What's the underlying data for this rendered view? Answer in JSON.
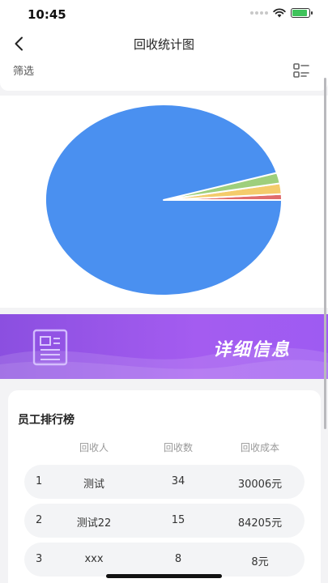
{
  "status_bar": {
    "time": "10:45",
    "battery_level": 0.9,
    "battery_color": "#3fc35b"
  },
  "nav": {
    "title": "回收统计图",
    "back_icon": "chevron-left-icon"
  },
  "filter": {
    "label": "筛选",
    "icon": "filter-list-icon"
  },
  "chart_data": {
    "type": "pie",
    "title": "",
    "slices": [
      {
        "value": 1,
        "color": "#e06c6c"
      },
      {
        "value": 1.8,
        "color": "#f4cb6b"
      },
      {
        "value": 1.8,
        "color": "#9ecf7c"
      },
      {
        "value": 95.4,
        "color": "#4a90f0"
      }
    ]
  },
  "banner": {
    "title": "详细信息",
    "icon": "document-icon"
  },
  "ranking": {
    "title": "员工排行榜",
    "columns": [
      "回收人",
      "回收数",
      "回收成本"
    ],
    "rows": [
      {
        "index": "1",
        "name": "测试",
        "count": "34",
        "cost": "30006元"
      },
      {
        "index": "2",
        "name": "测试22",
        "count": "15",
        "cost": "84205元"
      },
      {
        "index": "3",
        "name": "xxx",
        "count": "8",
        "cost": "8元"
      }
    ]
  },
  "colors": {
    "accent_purple": "#9b57ee",
    "pie_blue": "#4a90f0"
  }
}
